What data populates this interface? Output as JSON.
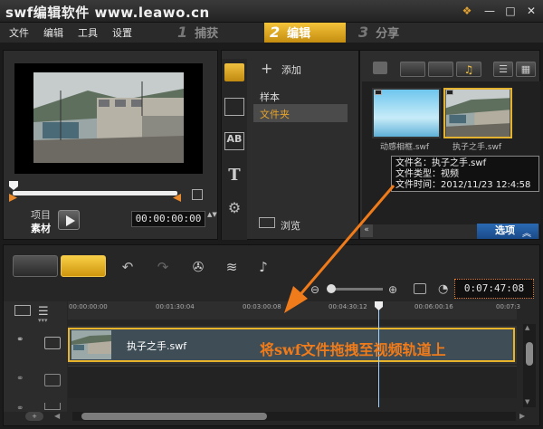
{
  "window": {
    "title": "swf编辑软件 www.leawo.cn",
    "controls": [
      "❖",
      "—",
      "□",
      "✕"
    ]
  },
  "menu": [
    "文件",
    "编辑",
    "工具",
    "设置"
  ],
  "steps": [
    {
      "num": "1",
      "label": "捕获"
    },
    {
      "num": "2",
      "label": "编辑"
    },
    {
      "num": "3",
      "label": "分享"
    }
  ],
  "preview": {
    "mode_project": "项目",
    "mode_clip": "素材",
    "timecode": "00:00:00:00",
    "timecode_arrows": "▲▼"
  },
  "library": {
    "add_label": "添加",
    "folders": [
      "样本",
      "文件夹"
    ],
    "browse_label": "浏览",
    "thumbs": [
      {
        "label": "动感相框.swf"
      },
      {
        "label": "执子之手.swf"
      }
    ],
    "tooltip": {
      "line1": "文件名：执子之手.swf",
      "line2": "文件类型：视频",
      "line3": "文件时间：2012/11/23 12:4:58"
    },
    "options_label": "选项"
  },
  "timeline": {
    "timecode": "0:07:47:08",
    "ruler_ticks": [
      "00:00:00:00",
      "00:01:30:04",
      "00:03:00:08",
      "00:04:30:12",
      "00:06:00:16",
      "00:07:3"
    ],
    "clip_name": "执子之手.swf",
    "annotation": "将swf文件拖拽至视频轨道上"
  },
  "colors": {
    "accent": "#e8a42b",
    "annotation": "#f07b1a",
    "tab_active": "#f4c43a",
    "options_blue": "#2a6ab3"
  }
}
